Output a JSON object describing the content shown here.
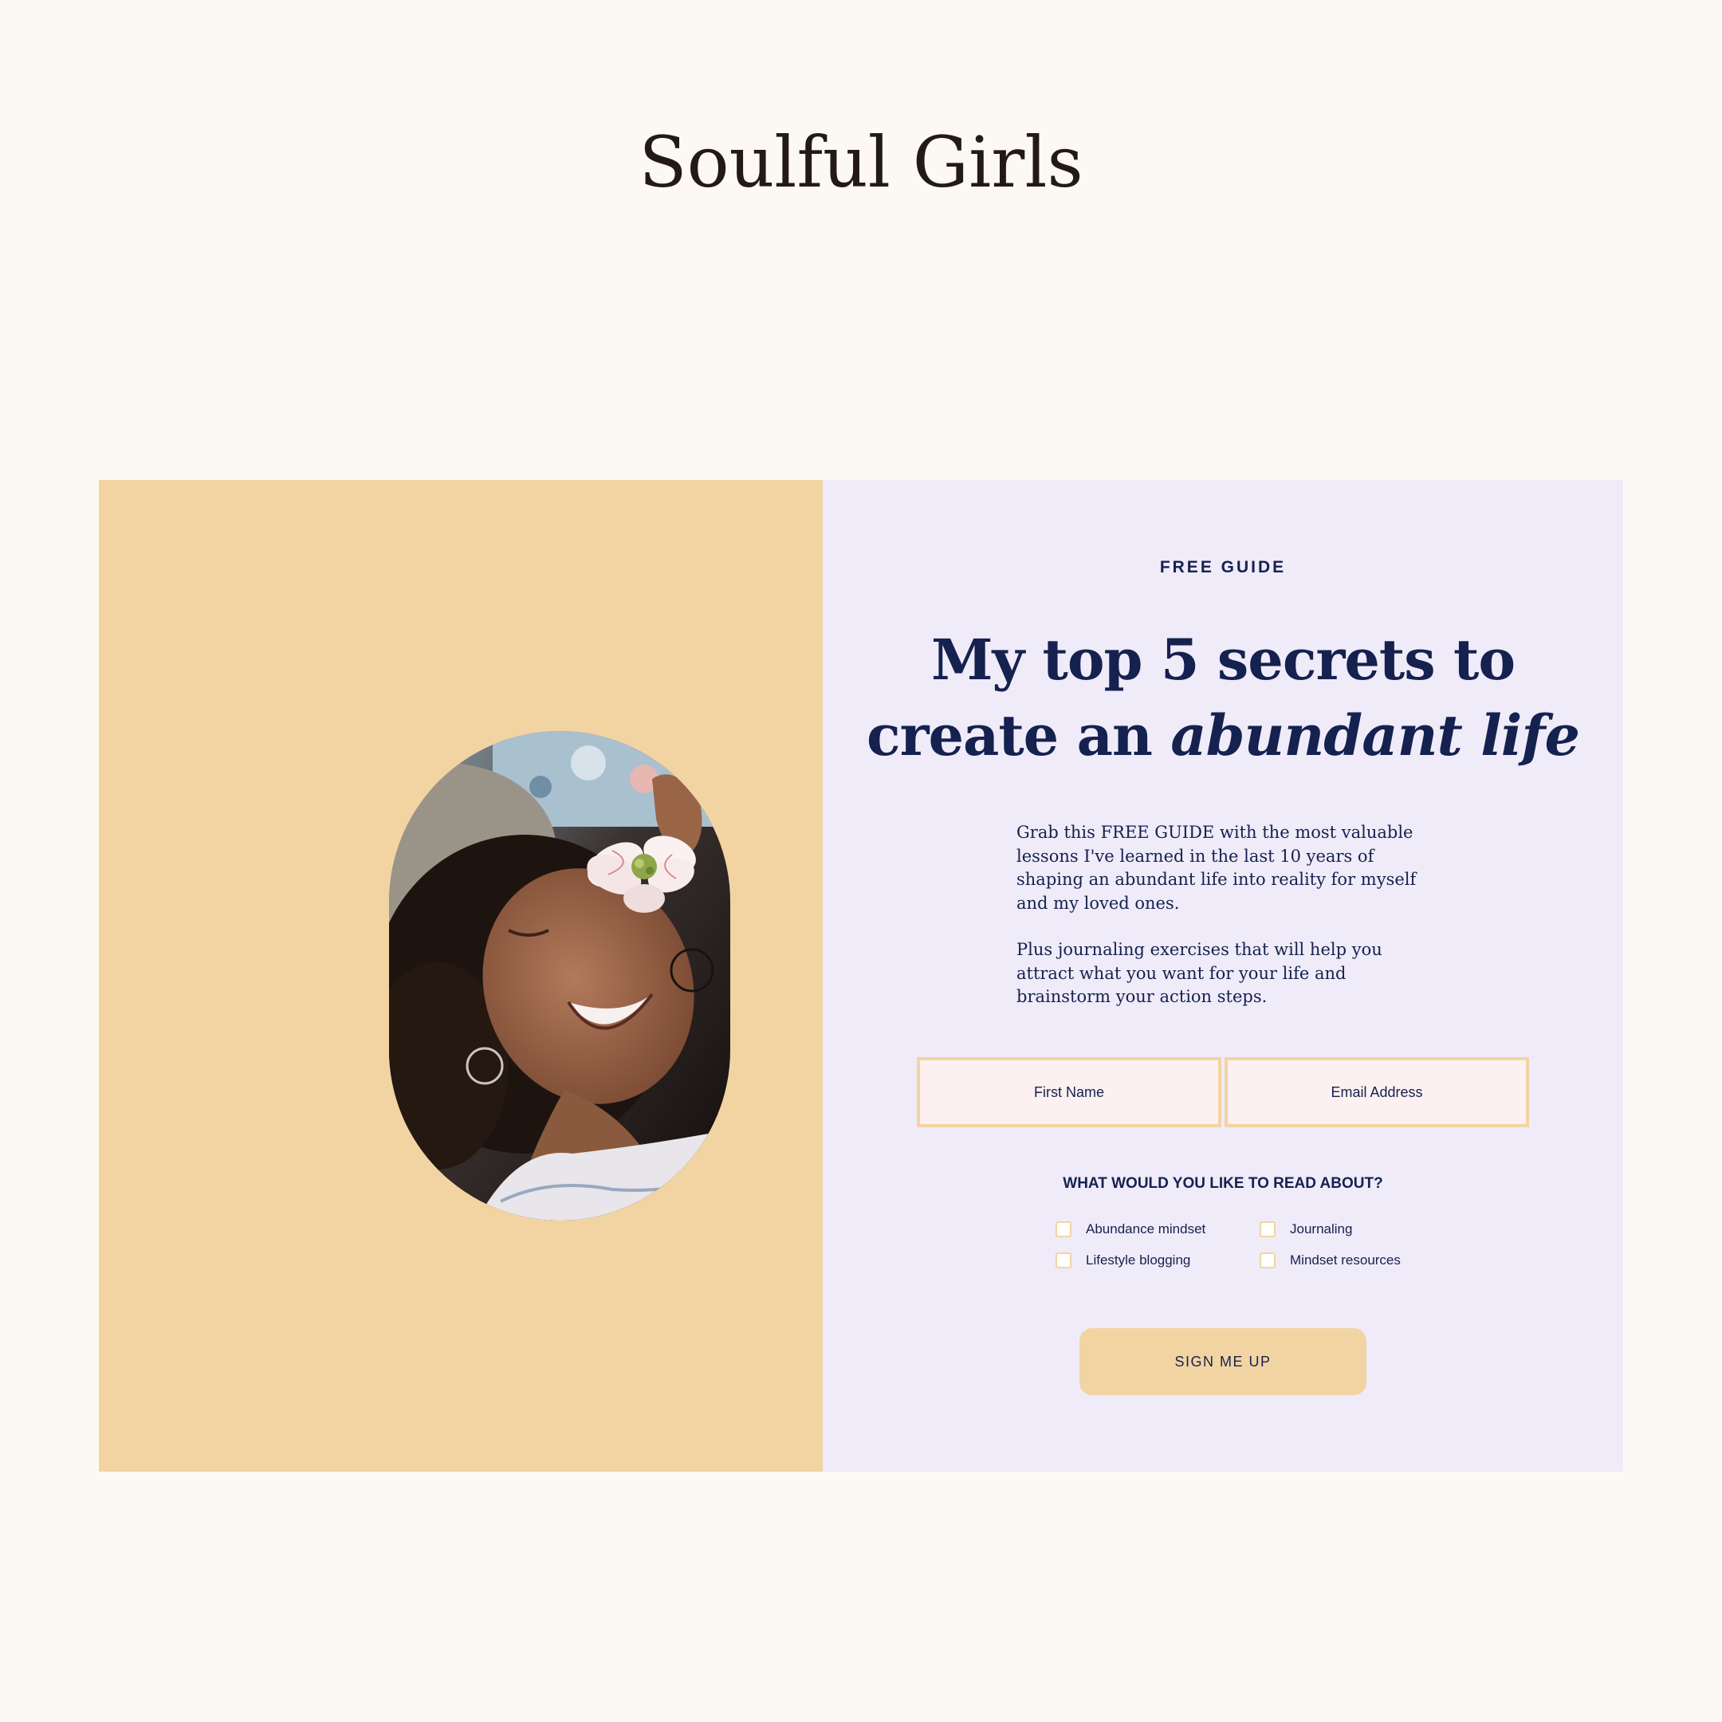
{
  "site": {
    "brand_name": "Soulful Girls"
  },
  "optin": {
    "eyebrow": "FREE GUIDE",
    "headline_part1": "My top 5 secrets to",
    "headline_part2": "create an ",
    "headline_italic": "abundant life",
    "paragraph1": "Grab this FREE GUIDE with the most valuable lessons I've learned in the last 10 years of shaping an abundant life into reality for myself and my loved ones.",
    "paragraph2": "Plus journaling exercises that will help you attract what you want for your life and brainstorm your action steps.",
    "first_name_placeholder": "First Name",
    "email_placeholder": "Email Address",
    "interests_question": "WHAT WOULD YOU LIKE TO READ ABOUT?",
    "interests": [
      {
        "label": "Abundance mindset",
        "checked": false
      },
      {
        "label": "Journaling",
        "checked": false
      },
      {
        "label": "Lifestyle blogging",
        "checked": false
      },
      {
        "label": "Mindset resources",
        "checked": false
      }
    ],
    "submit_label": "SIGN ME UP"
  },
  "colors": {
    "page_background": "#fcf9f4",
    "left_panel": "#f2d4a3",
    "right_panel": "#efebf8",
    "navy_text": "#15214f",
    "input_background": "#fdf0f1",
    "accent": "#f2d4a3"
  },
  "image": {
    "subject": "smiling woman lying down holding a white flower over her eye"
  }
}
